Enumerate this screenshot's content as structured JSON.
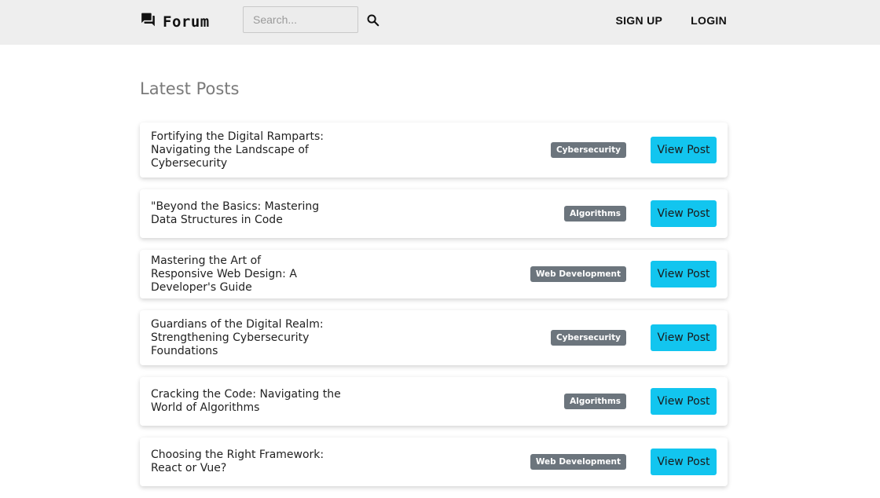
{
  "header": {
    "brand_name": "Forum",
    "brand_icon": "forum-icon",
    "search_placeholder": "Search...",
    "search_icon": "search-icon",
    "sign_up_label": "SIGN UP",
    "login_label": "LOGIN"
  },
  "main": {
    "title": "Latest Posts",
    "posts": [
      {
        "title": "Fortifying the Digital Ramparts: Navigating the Landscape of Cybersecurity",
        "tag": "Cybersecurity",
        "button": "View Post"
      },
      {
        "title": "\"Beyond the Basics: Mastering Data Structures in Code",
        "tag": "Algorithms",
        "button": "View Post"
      },
      {
        "title": "Mastering the Art of Responsive Web Design: A Developer's Guide",
        "tag": "Web Development",
        "button": "View Post"
      },
      {
        "title": "Guardians of the Digital Realm: Strengthening Cybersecurity Foundations",
        "tag": "Cybersecurity",
        "button": "View Post"
      },
      {
        "title": "Cracking the Code: Navigating the World of Algorithms",
        "tag": "Algorithms",
        "button": "View Post"
      },
      {
        "title": "Choosing the Right Framework: React or Vue?",
        "tag": "Web Development",
        "button": "View Post"
      }
    ]
  },
  "colors": {
    "header_bg": "#eeeeee",
    "tag_bg": "#6c757d",
    "button_bg": "#12c5ef"
  }
}
